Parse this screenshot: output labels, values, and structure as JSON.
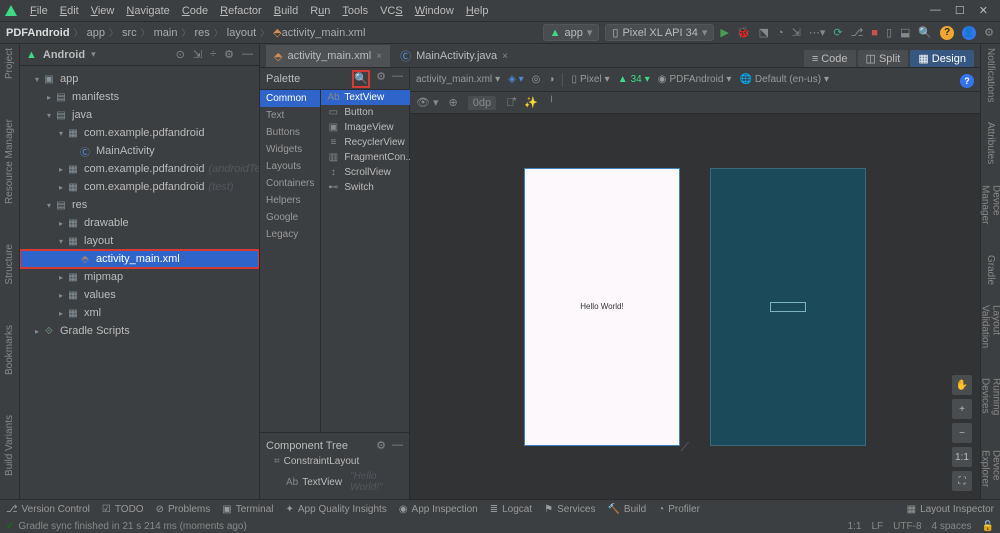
{
  "menu": [
    "File",
    "Edit",
    "View",
    "Navigate",
    "Code",
    "Refactor",
    "Build",
    "Run",
    "Tools",
    "VCS",
    "Window",
    "Help"
  ],
  "breadcrumb": [
    "PDFAndroid",
    "app",
    "src",
    "main",
    "res",
    "layout",
    "activity_main.xml"
  ],
  "device_selectors": {
    "app": "app",
    "device": "Pixel XL API 34"
  },
  "panel": {
    "title": "Android"
  },
  "tree": {
    "app": "app",
    "manifests": "manifests",
    "java": "java",
    "pkg": "com.example.pdfandroid",
    "main_activity": "MainActivity",
    "pkg_at": "com.example.pdfandroid",
    "pkg_at_suffix": "(androidTest)",
    "pkg_test": "com.example.pdfandroid",
    "pkg_test_suffix": "(test)",
    "res": "res",
    "drawable": "drawable",
    "layout": "layout",
    "layout_file": "activity_main.xml",
    "mipmap": "mipmap",
    "values": "values",
    "xml": "xml",
    "gradle": "Gradle Scripts"
  },
  "tabs": {
    "t1": "activity_main.xml",
    "t2": "MainActivity.java"
  },
  "palette": {
    "header": "Palette",
    "cats": [
      "Common",
      "Text",
      "Buttons",
      "Widgets",
      "Layouts",
      "Containers",
      "Helpers",
      "Google",
      "Legacy"
    ],
    "items": [
      {
        "icon": "Ab",
        "label": "TextView"
      },
      {
        "icon": "▭",
        "label": "Button"
      },
      {
        "icon": "▣",
        "label": "ImageView"
      },
      {
        "icon": "≡",
        "label": "RecyclerView"
      },
      {
        "icon": "▥",
        "label": "FragmentCon..."
      },
      {
        "icon": "↕",
        "label": "ScrollView"
      },
      {
        "icon": "⊷",
        "label": "Switch"
      }
    ]
  },
  "comp_tree": {
    "header": "Component Tree",
    "root": "ConstraintLayout",
    "child": "TextView",
    "child_prefix": "Ab",
    "child_text": "\"Hello World!\""
  },
  "design_toolbar": {
    "file": "activity_main.xml",
    "device": "Pixel",
    "api": "34",
    "theme": "PDFAndroid",
    "locale": "Default (en-us)",
    "margin": "0dp"
  },
  "view_modes": {
    "code": "Code",
    "split": "Split",
    "design": "Design"
  },
  "preview": {
    "hello": "Hello World!"
  },
  "zoom": {
    "one": "1:1",
    "fit": "⛶"
  },
  "bottom": {
    "vc": "Version Control",
    "todo": "TODO",
    "problems": "Problems",
    "terminal": "Terminal",
    "quality": "App Quality Insights",
    "inspection": "App Inspection",
    "logcat": "Logcat",
    "services": "Services",
    "build": "Build",
    "profiler": "Profiler",
    "layout_inspector": "Layout Inspector"
  },
  "status": {
    "msg": "Gradle sync finished in 21 s 214 ms (moments ago)",
    "pos": "1:1",
    "line_sep": "LF",
    "encoding": "UTF-8",
    "indent": "4 spaces"
  },
  "left_strip": [
    "Project",
    "Resource Manager",
    "Structure",
    "Bookmarks",
    "Build Variants"
  ],
  "right_strip": [
    "Notifications",
    "Attributes",
    "Device Manager",
    "Gradle",
    "Layout Validation",
    "Running Devices",
    "Device Explorer"
  ]
}
